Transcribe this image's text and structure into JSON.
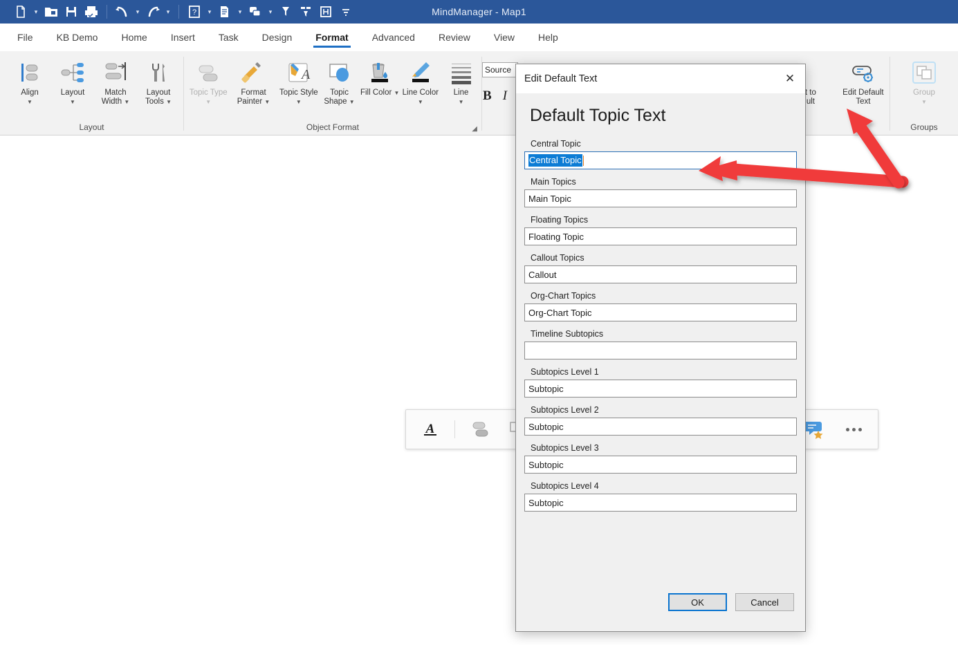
{
  "window": {
    "app_title": "MindManager - Map1"
  },
  "quick_access": [
    {
      "name": "new-icon",
      "glyph": "new"
    },
    {
      "name": "open-icon",
      "glyph": "open"
    },
    {
      "name": "save-icon",
      "glyph": "save"
    },
    {
      "name": "print-icon",
      "glyph": "print"
    },
    {
      "name": "undo-icon",
      "glyph": "undo"
    },
    {
      "name": "redo-icon",
      "glyph": "redo"
    },
    {
      "name": "help-icon",
      "glyph": "help"
    },
    {
      "name": "notes-icon",
      "glyph": "notes"
    },
    {
      "name": "topic-link-icon",
      "glyph": "link"
    },
    {
      "name": "filter-icon",
      "glyph": "filter"
    },
    {
      "name": "filter-branch-icon",
      "glyph": "filterbranch"
    },
    {
      "name": "fit-map-icon",
      "glyph": "fit"
    },
    {
      "name": "customize-qat-icon",
      "glyph": "more"
    }
  ],
  "tabs": [
    {
      "label": "File",
      "active": false
    },
    {
      "label": "KB Demo",
      "active": false
    },
    {
      "label": "Home",
      "active": false
    },
    {
      "label": "Insert",
      "active": false
    },
    {
      "label": "Task",
      "active": false
    },
    {
      "label": "Design",
      "active": false
    },
    {
      "label": "Format",
      "active": true
    },
    {
      "label": "Advanced",
      "active": false
    },
    {
      "label": "Review",
      "active": false
    },
    {
      "label": "View",
      "active": false
    },
    {
      "label": "Help",
      "active": false
    }
  ],
  "ribbon": {
    "groups": [
      {
        "title": "Layout",
        "items": [
          {
            "label": "Align",
            "caret": true,
            "icon": "align-icon",
            "disabled": false
          },
          {
            "label": "Layout",
            "caret": true,
            "icon": "layout-icon",
            "disabled": false
          },
          {
            "label": "Match Width",
            "caret": true,
            "icon": "match-width-icon",
            "disabled": false
          },
          {
            "label": "Layout Tools",
            "caret": true,
            "icon": "layout-tools-icon",
            "disabled": false
          }
        ]
      },
      {
        "title": "Object Format",
        "items": [
          {
            "label": "Topic Type",
            "caret": true,
            "icon": "topic-type-icon",
            "disabled": true
          },
          {
            "label": "Format Painter",
            "caret": true,
            "icon": "format-painter-icon",
            "disabled": false
          },
          {
            "label": "Topic Style",
            "caret": true,
            "icon": "topic-style-icon",
            "disabled": false
          },
          {
            "label": "Topic Shape",
            "caret": true,
            "icon": "topic-shape-icon",
            "disabled": false
          },
          {
            "label": "Fill Color",
            "caret": true,
            "icon": "fill-color-icon",
            "disabled": false
          },
          {
            "label": "Line Color",
            "caret": true,
            "icon": "line-color-icon",
            "disabled": false
          },
          {
            "label": "Line",
            "caret": true,
            "icon": "line-weight-icon",
            "disabled": false
          }
        ]
      },
      {
        "title": "Groups",
        "items": [
          {
            "label": "Group",
            "caret": true,
            "icon": "group-icon",
            "disabled": true
          }
        ]
      }
    ],
    "source_label": "Source",
    "bold_label": "B",
    "italic_label": "I",
    "set_to_default_label_line1": "t to",
    "set_to_default_label_line2": "ult",
    "edit_default_text_label": "Edit Default Text"
  },
  "float_toolbar": {
    "buttons": [
      {
        "name": "text-format-icon",
        "label": "A"
      },
      {
        "name": "topic-layout-icon",
        "label": ""
      },
      {
        "name": "topic-shape-fill-icon",
        "label": ""
      },
      {
        "name": "comment-icon",
        "label": ""
      },
      {
        "name": "more-options-icon",
        "label": "..."
      }
    ]
  },
  "dialog": {
    "titlebar_text": "Edit Default Text",
    "close_glyph": "✕",
    "heading": "Default Topic Text",
    "fields": [
      {
        "label": "Central Topic",
        "value": "Central Topic",
        "selected": true,
        "focused": true
      },
      {
        "label": "Main Topics",
        "value": "Main Topic",
        "selected": false,
        "focused": false
      },
      {
        "label": "Floating Topics",
        "value": "Floating Topic",
        "selected": false,
        "focused": false
      },
      {
        "label": "Callout Topics",
        "value": "Callout",
        "selected": false,
        "focused": false
      },
      {
        "label": "Org-Chart Topics",
        "value": "Org-Chart Topic",
        "selected": false,
        "focused": false
      },
      {
        "label": "Timeline Subtopics",
        "value": "",
        "selected": false,
        "focused": false
      },
      {
        "label": "Subtopics Level 1",
        "value": "Subtopic",
        "selected": false,
        "focused": false
      },
      {
        "label": "Subtopics Level 2",
        "value": "Subtopic",
        "selected": false,
        "focused": false
      },
      {
        "label": "Subtopics Level 3",
        "value": "Subtopic",
        "selected": false,
        "focused": false
      },
      {
        "label": "Subtopics Level 4",
        "value": "Subtopic",
        "selected": false,
        "focused": false
      }
    ],
    "ok_label": "OK",
    "cancel_label": "Cancel"
  },
  "annotations": {
    "arrow_color": "#f03a3a",
    "arrows": [
      {
        "name": "arrow-to-central-topic-field"
      },
      {
        "name": "arrow-to-edit-default-text-button"
      }
    ]
  },
  "colors": {
    "titlebar_blue": "#2b579a",
    "accent_blue": "#1e6fc4",
    "selection_blue": "#0c7cd5",
    "ribbon_bg": "#f2f2f2",
    "dialog_bg": "#f0f0f0"
  }
}
